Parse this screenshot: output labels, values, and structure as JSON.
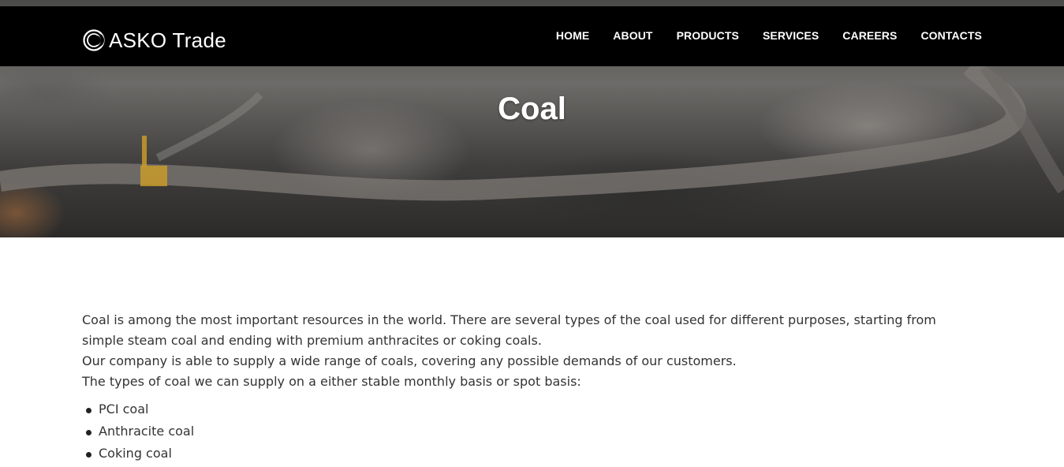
{
  "brand": {
    "name": "ASKO Trade",
    "logo_icon": "crescent-logo-icon"
  },
  "nav": {
    "items": [
      {
        "label": "HOME"
      },
      {
        "label": "ABOUT"
      },
      {
        "label": "PRODUCTS"
      },
      {
        "label": "SERVICES"
      },
      {
        "label": "CAREERS"
      },
      {
        "label": "CONTACTS"
      }
    ]
  },
  "hero": {
    "title": "Coal"
  },
  "content": {
    "paragraphs": [
      "Coal is among the most important resources in the world. There are several types of the coal used for different purposes, starting from simple steam coal and ending with premium anthracites or coking coals.",
      "Our company is able to supply a wide range of coals, covering any possible demands of our customers.",
      "The types of coal we can supply on a either stable monthly basis or spot basis:"
    ],
    "list": [
      "PCI coal",
      "Anthracite coal",
      "Coking coal"
    ]
  },
  "colors": {
    "header_bg": "#000000",
    "text": "#333333",
    "title": "#ffffff"
  }
}
